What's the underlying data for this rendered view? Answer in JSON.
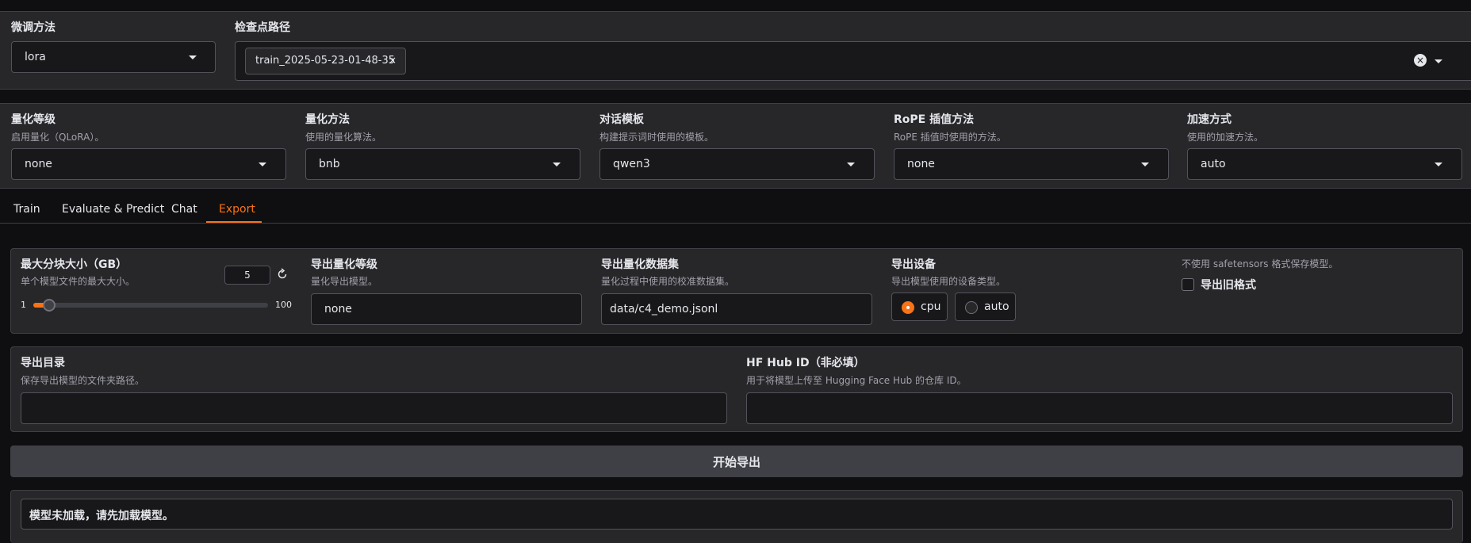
{
  "top": {
    "finetune_label": "微调方法",
    "finetune_value": "lora",
    "checkpoint_label": "检查点路径",
    "checkpoint_chip": "train_2025-05-23-01-48-35",
    "chip_remove": "×",
    "clear": "×"
  },
  "settings": [
    {
      "label": "量化等级",
      "desc": "启用量化（QLoRA）。",
      "value": "none"
    },
    {
      "label": "量化方法",
      "desc": "使用的量化算法。",
      "value": "bnb"
    },
    {
      "label": "对话模板",
      "desc": "构建提示词时使用的模板。",
      "value": "qwen3"
    },
    {
      "label": "RoPE 插值方法",
      "desc": "RoPE 插值时使用的方法。",
      "value": "none"
    },
    {
      "label": "加速方式",
      "desc": "使用的加速方法。",
      "value": "auto"
    }
  ],
  "tabs": [
    "Train",
    "Evaluate & Predict",
    "Chat",
    "Export"
  ],
  "active_tab": "Export",
  "export": {
    "shard_label": "最大分块大小（GB）",
    "shard_desc": "单个模型文件的最大大小。",
    "shard_value": "5",
    "shard_min": "1",
    "shard_max": "100",
    "shard_fraction": 0.04,
    "quant_label": "导出量化等级",
    "quant_desc": "量化导出模型。",
    "quant_value": "none",
    "dataset_label": "导出量化数据集",
    "dataset_desc": "量化过程中使用的校准数据集。",
    "dataset_value": "data/c4_demo.jsonl",
    "device_label": "导出设备",
    "device_desc": "导出模型使用的设备类型。",
    "device_options": [
      "cpu",
      "auto"
    ],
    "device_selected": "cpu",
    "legacy_desc": "不使用 safetensors 格式保存模型。",
    "legacy_label": "导出旧格式",
    "dir_label": "导出目录",
    "dir_desc": "保存导出模型的文件夹路径。",
    "dir_value": "",
    "hub_label": "HF Hub ID（非必填）",
    "hub_desc": "用于将模型上传至 Hugging Face Hub 的仓库 ID。",
    "hub_value": "",
    "button": "开始导出",
    "output": "模型未加载，请先加载模型。"
  },
  "colors": {
    "accent": "#f97316",
    "panel": "#27272a",
    "input": "#18181b",
    "border": "#52525b"
  }
}
